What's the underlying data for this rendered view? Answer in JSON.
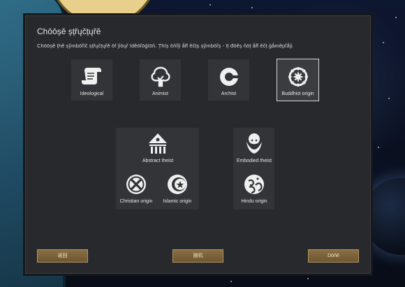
{
  "dialog": {
    "title": "Chōōșě șțřųčțųřě",
    "subtitle": "Chōōșě țhě șўmbōľīč șțřųčțųřě ōf ўōųř īděōľōģīōň. Țhīș ōňľў ǻff ěčțș șўmbōľș - īț đōěș ňōț ǻff ěčț ģǻměpľǻў."
  },
  "structures": [
    {
      "label": "Ideological",
      "icon": "scroll-icon"
    },
    {
      "label": "Animist",
      "icon": "tree-icon"
    },
    {
      "label": "Archist",
      "icon": "archist-ring-icon"
    },
    {
      "label": "Buddhist origin",
      "icon": "dharma-wheel-icon",
      "selected": true
    }
  ],
  "groups": {
    "abstract": {
      "main": {
        "label": "Abstract theist",
        "icon": "temple-eye-icon"
      },
      "children": [
        {
          "label": "Christian origin",
          "icon": "cross-circle-icon"
        },
        {
          "label": "Islamic origin",
          "icon": "crescent-star-icon"
        }
      ]
    },
    "embodied": {
      "main": {
        "label": "Embodied theist",
        "icon": "bearded-god-icon"
      },
      "children": [
        {
          "label": "Hindu origin",
          "icon": "om-icon"
        }
      ]
    }
  },
  "buttons": {
    "back": "返回",
    "random": "随机",
    "done": "Dōňě"
  },
  "colors": {
    "dialog_bg": "#27292c",
    "tile_bg": "#323437",
    "button_bg": "#7b623a"
  }
}
